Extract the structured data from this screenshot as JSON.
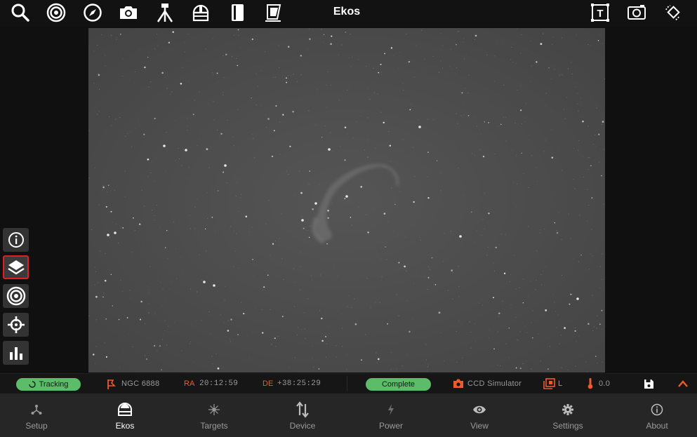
{
  "app": {
    "title": "Ekos"
  },
  "top_toolbar": {
    "left_icons": [
      "search-icon",
      "target-icon",
      "compass-icon",
      "camera-icon",
      "telescope-icon",
      "observatory-icon",
      "notebook-icon",
      "flat-panel-icon"
    ],
    "right_icons": [
      "text-frame-icon",
      "camera-frame-icon",
      "rotate-icon"
    ]
  },
  "side_tools": [
    "info-icon",
    "layers-icon",
    "target-icon",
    "crosshair-icon",
    "histogram-icon"
  ],
  "status": {
    "mount_state": "Tracking",
    "target_name": "NGC 6888",
    "ra_label": "RA",
    "ra_value": "20:12:59",
    "de_label": "DE",
    "de_value": "+38:25:29",
    "capture_state": "Complete",
    "camera": "CCD Simulator",
    "filter": "L",
    "temperature": "0.0"
  },
  "bottom_nav": [
    {
      "label": "Setup",
      "icon": "network-icon",
      "active": false
    },
    {
      "label": "Ekos",
      "icon": "ekos-dome-icon",
      "active": true
    },
    {
      "label": "Targets",
      "icon": "sparkle-icon",
      "active": false
    },
    {
      "label": "Device",
      "icon": "swap-arrows-icon",
      "active": false
    },
    {
      "label": "Power",
      "icon": "bolt-icon",
      "active": false
    },
    {
      "label": "View",
      "icon": "eye-icon",
      "active": false
    },
    {
      "label": "Settings",
      "icon": "gear-icon",
      "active": false
    },
    {
      "label": "About",
      "icon": "info-icon",
      "active": false
    }
  ],
  "colors": {
    "accent_green": "#5bbd6a",
    "accent_orange": "#ef5a2a",
    "active_highlight": "#e02020"
  }
}
